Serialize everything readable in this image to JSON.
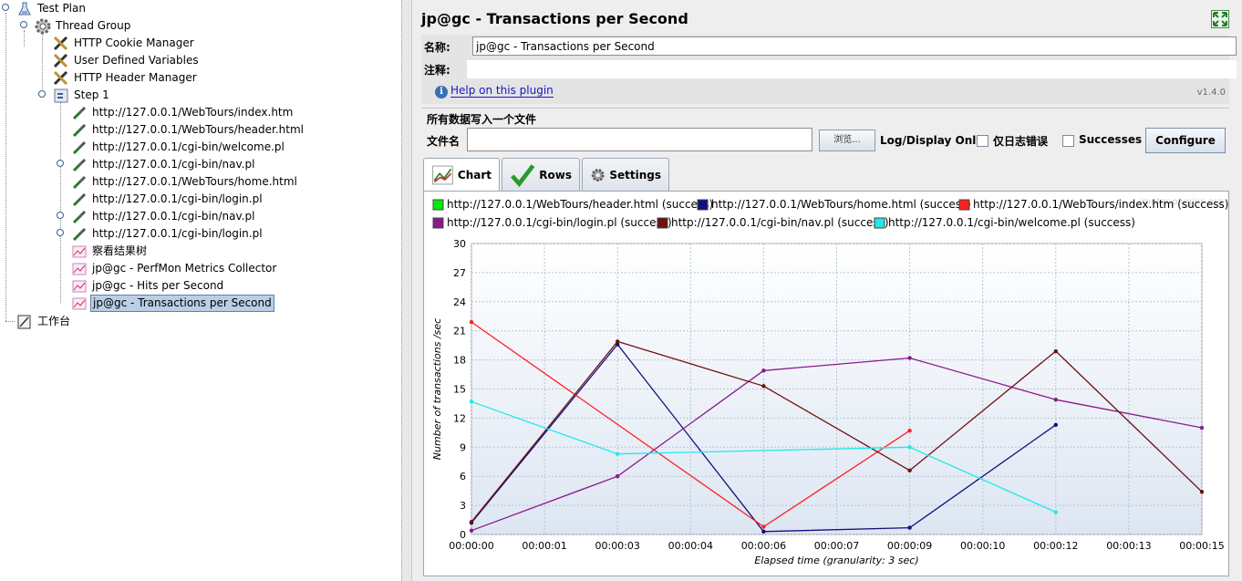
{
  "tree": {
    "items": [
      {
        "label": "Test Plan",
        "icon": "flask-icon"
      },
      {
        "label": "Thread Group",
        "icon": "gear-icon"
      },
      {
        "label": "HTTP Cookie Manager",
        "icon": "tools-icon"
      },
      {
        "label": "User Defined Variables",
        "icon": "tools-icon"
      },
      {
        "label": "HTTP Header Manager",
        "icon": "tools-icon"
      },
      {
        "label": "Step 1",
        "icon": "controller-icon"
      },
      {
        "label": "http://127.0.0.1/WebTours/index.htm",
        "icon": "pipette-icon"
      },
      {
        "label": "http://127.0.0.1/WebTours/header.html",
        "icon": "pipette-icon"
      },
      {
        "label": "http://127.0.0.1/cgi-bin/welcome.pl",
        "icon": "pipette-icon"
      },
      {
        "label": "http://127.0.0.1/cgi-bin/nav.pl",
        "icon": "pipette-icon"
      },
      {
        "label": "http://127.0.0.1/WebTours/home.html",
        "icon": "pipette-icon"
      },
      {
        "label": "http://127.0.0.1/cgi-bin/login.pl",
        "icon": "pipette-icon"
      },
      {
        "label": "http://127.0.0.1/cgi-bin/nav.pl",
        "icon": "pipette-icon"
      },
      {
        "label": "http://127.0.0.1/cgi-bin/login.pl",
        "icon": "pipette-icon"
      },
      {
        "label": "察看结果树",
        "icon": "graph-icon"
      },
      {
        "label": "jp@gc - PerfMon Metrics Collector",
        "icon": "graph-icon"
      },
      {
        "label": "jp@gc - Hits per Second",
        "icon": "graph-icon"
      },
      {
        "label": "jp@gc - Transactions per Second",
        "icon": "graph-icon"
      },
      {
        "label": "工作台",
        "icon": "workbench-icon"
      }
    ]
  },
  "panel": {
    "title": "jp@gc - Transactions per Second",
    "name_label": "名称:",
    "name_value": "jp@gc - Transactions per Second",
    "comment_label": "注释:",
    "help_link": "Help on this plugin",
    "version": "v1.4.0",
    "file_group_title": "所有数据写入一个文件",
    "file_label": "文件名",
    "browse_label": "浏览...",
    "log_display_label": "Log/Display Only:",
    "errors_only_label": "仅日志错误",
    "successes_label": "Successes",
    "configure_label": "Configure",
    "tabs": [
      {
        "label": "Chart",
        "icon": "chart-icon"
      },
      {
        "label": "Rows",
        "icon": "checkmark-icon"
      },
      {
        "label": "Settings",
        "icon": "gear-icon"
      }
    ],
    "watermark": "jmeter-plugins.org"
  },
  "chart_data": {
    "type": "line",
    "xlabel": "Elapsed time (granularity: 3 sec)",
    "ylabel": "Number of transactions /sec",
    "ylim": [
      0,
      30
    ],
    "yticks": [
      0,
      3,
      6,
      9,
      12,
      15,
      18,
      21,
      24,
      27,
      30
    ],
    "xticks": [
      "00:00:00",
      "00:00:01",
      "00:00:03",
      "00:00:04",
      "00:00:06",
      "00:00:07",
      "00:00:09",
      "00:00:10",
      "00:00:12",
      "00:00:13",
      "00:00:15"
    ],
    "xlim": [
      0,
      15
    ],
    "grid": true,
    "legend_position": "top",
    "series": [
      {
        "name": "http://127.0.0.1/WebTours/header.html (success)",
        "color": "#00ee00",
        "x": [],
        "y": []
      },
      {
        "name": "http://127.0.0.1/WebTours/home.html (success)",
        "color": "#101080",
        "x": [
          0,
          3,
          6,
          9,
          12
        ],
        "y": [
          1.2,
          19.6,
          0.3,
          0.7,
          11.3
        ]
      },
      {
        "name": "http://127.0.0.1/WebTours/index.htm (success)",
        "color": "#ff2020",
        "x": [
          0,
          6,
          9
        ],
        "y": [
          21.9,
          0.8,
          10.7
        ]
      },
      {
        "name": "http://127.0.0.1/cgi-bin/login.pl (success)",
        "color": "#8a1a8a",
        "x": [
          0,
          3,
          6,
          9,
          12,
          15
        ],
        "y": [
          0.4,
          6.0,
          16.9,
          18.2,
          13.9,
          11.0
        ]
      },
      {
        "name": "http://127.0.0.1/cgi-bin/nav.pl (success)",
        "color": "#701010",
        "x": [
          0,
          3,
          6,
          9,
          12,
          15
        ],
        "y": [
          1.3,
          19.9,
          15.3,
          6.6,
          18.9,
          4.4
        ]
      },
      {
        "name": "http://127.0.0.1/cgi-bin/welcome.pl (success)",
        "color": "#22e8e8",
        "x": [
          0,
          3,
          9,
          12
        ],
        "y": [
          13.7,
          8.3,
          9.0,
          2.3
        ]
      }
    ]
  }
}
